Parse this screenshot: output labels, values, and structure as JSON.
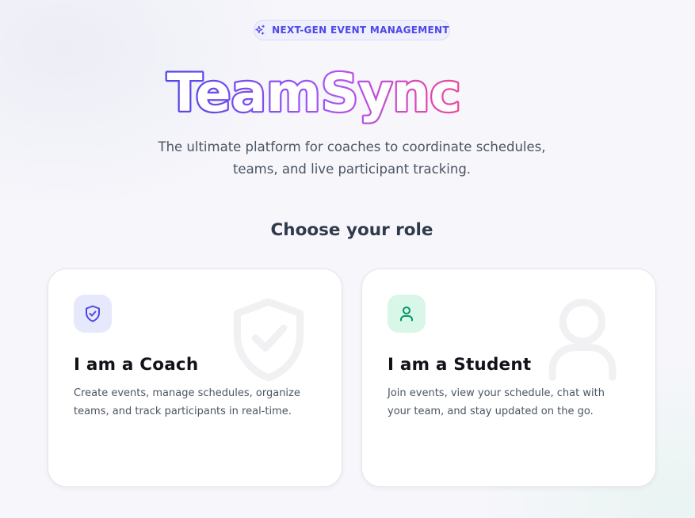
{
  "badge": {
    "label": "NEXT-GEN EVENT MANAGEMENT",
    "icon": "sparkles-icon"
  },
  "brand": {
    "name": "TeamSync",
    "gradient_start": "#4f46e5",
    "gradient_end": "#ec4899"
  },
  "subtitle": "The ultimate platform for coaches to coordinate schedules, teams, and live participant tracking.",
  "roles": {
    "heading": "Choose your role",
    "coach": {
      "title": "I am a Coach",
      "description": "Create events, manage schedules, organize teams, and track participants in real-time.",
      "icon": "shield-check-icon",
      "accent": "#4f46e5"
    },
    "student": {
      "title": "I am a Student",
      "description": "Join events, view your schedule, chat with your team, and stay updated on the go.",
      "icon": "user-icon",
      "accent": "#059669"
    }
  }
}
